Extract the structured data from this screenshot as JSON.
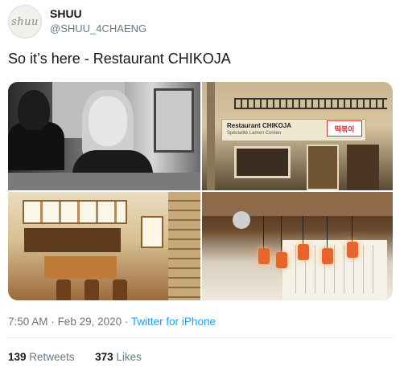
{
  "user": {
    "avatar_text": "shuu",
    "display_name": "SHUU",
    "handle": "@SHUU_4CHAENG"
  },
  "tweet": {
    "text": "So it’s here - Restaurant CHIKOJA"
  },
  "photos": {
    "sign_line1": "Restaurant CHIKOJA",
    "sign_line2": "Spécialité Lamen Coréen",
    "red_mark": "떡볶이"
  },
  "meta": {
    "time": "7:50 AM",
    "separator": "·",
    "date": "Feb 29, 2020",
    "source": "Twitter for iPhone"
  },
  "stats": {
    "retweets_count": "139",
    "retweets_label": "Retweets",
    "likes_count": "373",
    "likes_label": "Likes"
  },
  "colors": {
    "link": "#1da1f2",
    "secondary_text": "#657786",
    "primary_text": "#14171a"
  }
}
